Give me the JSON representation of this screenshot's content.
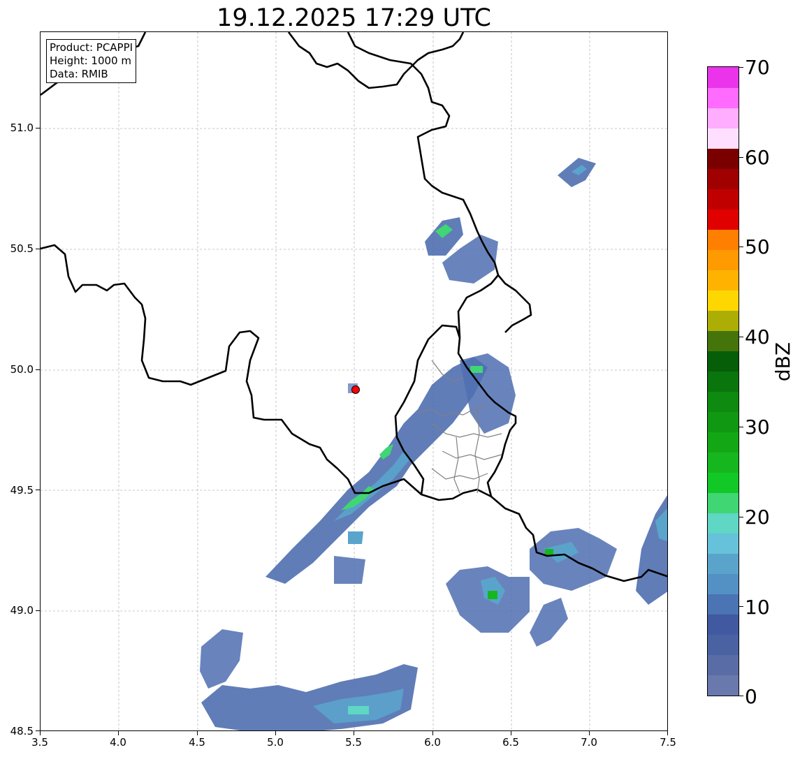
{
  "title": "19.12.2025 17:29 UTC",
  "info": {
    "product": "Product: PCAPPI",
    "height": "Height: 1000 m",
    "data": "Data: RMIB"
  },
  "axes": {
    "x_ticks": [
      "3.5",
      "4.0",
      "4.5",
      "5.0",
      "5.5",
      "6.0",
      "6.5",
      "7.0",
      "7.5"
    ],
    "y_ticks": [
      "51.0",
      "50.5",
      "50.0",
      "49.5",
      "49.0",
      "48.5"
    ],
    "x_range": [
      3.5,
      7.5
    ],
    "y_range": [
      48.5,
      51.4
    ]
  },
  "colorbar": {
    "label": "dBZ",
    "tick_labels": [
      "0",
      "10",
      "20",
      "30",
      "40",
      "50",
      "60",
      "70"
    ],
    "range": [
      0,
      70
    ],
    "colors": [
      "#6a79ad",
      "#5a6ca5",
      "#4a62a2",
      "#4159a1",
      "#4a74b3",
      "#5391c4",
      "#5aa4cc",
      "#66c2da",
      "#60d6c4",
      "#3fd673",
      "#12c826",
      "#16b71e",
      "#13a716",
      "#119812",
      "#0d8a0f",
      "#0a750d",
      "#065e09",
      "#45750a",
      "#acae06",
      "#ffd700",
      "#ffb300",
      "#ff9a00",
      "#ff7f00",
      "#e00000",
      "#c00000",
      "#a00000",
      "#7a0000",
      "#ffdfff",
      "#ffadff",
      "#ff6bff",
      "#ec33ec"
    ]
  },
  "radar_site": {
    "lon": 5.505,
    "lat": 49.914,
    "color": "#ff0000"
  },
  "colors": {
    "border": "#000000",
    "admin": "#808080",
    "grid": "#b5b5b5"
  }
}
